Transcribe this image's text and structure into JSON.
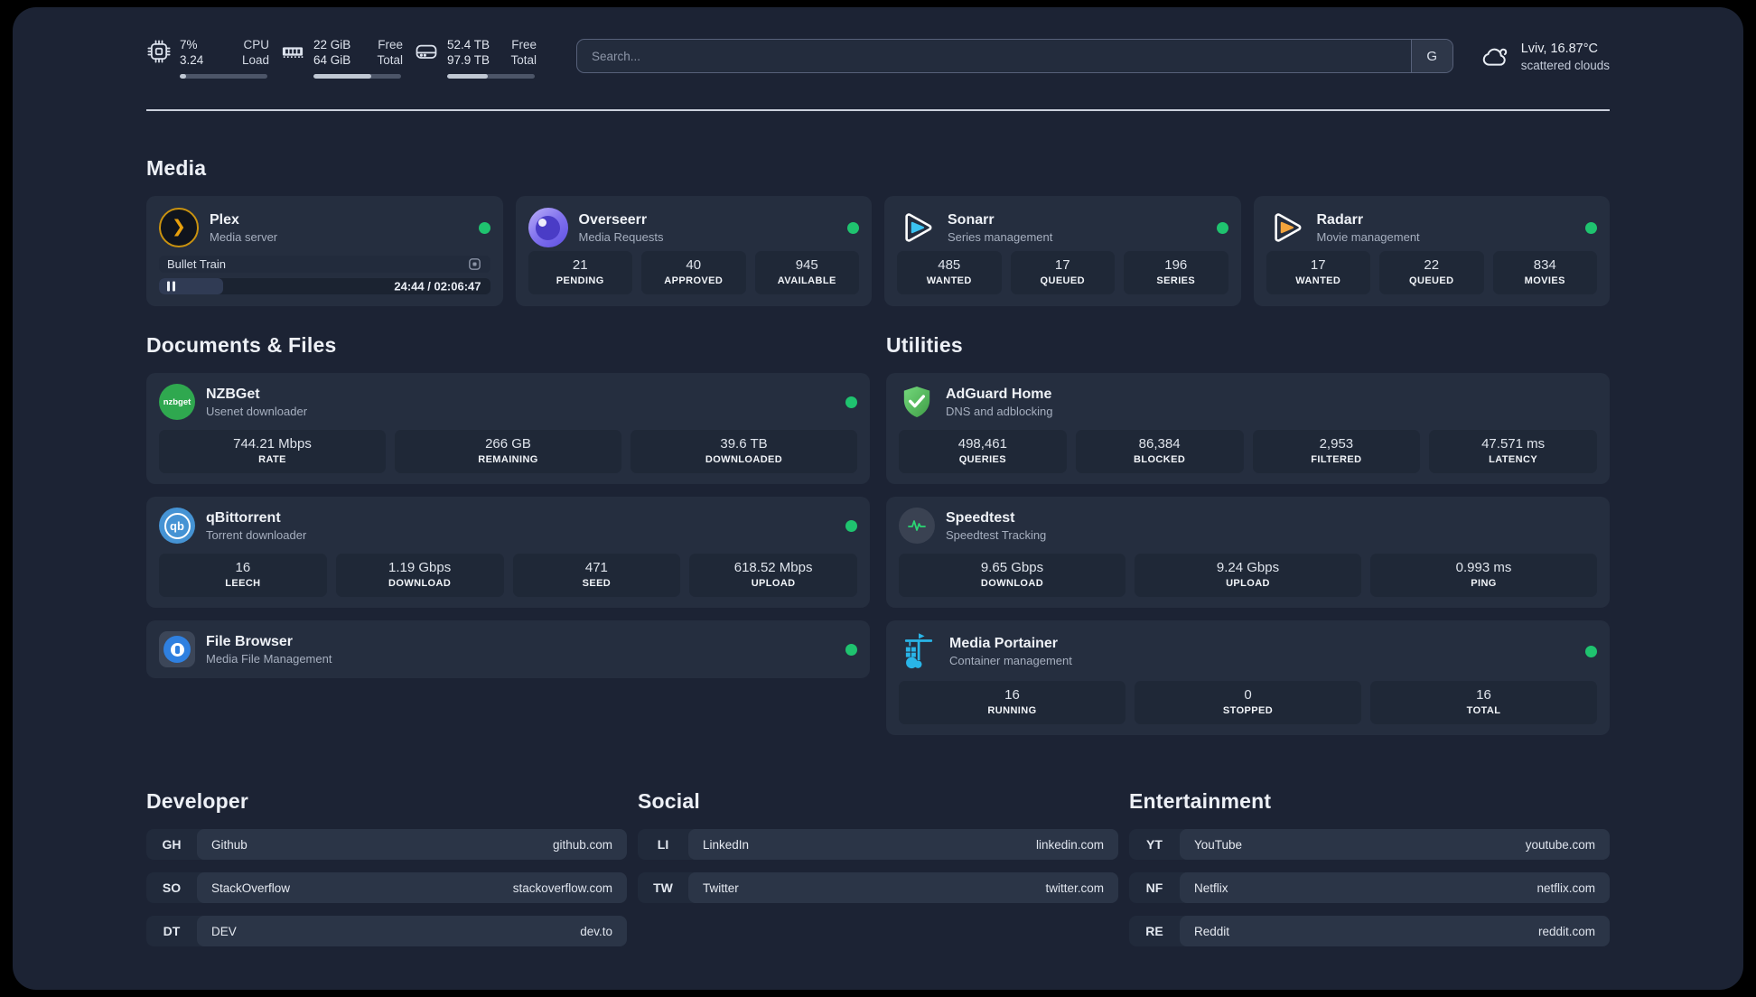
{
  "topbar": {
    "cpu": {
      "value_top": "7%",
      "value_bottom": "3.24",
      "label_top": "CPU",
      "label_bottom": "Load",
      "progress_pct": 7
    },
    "ram": {
      "value_top": "22 GiB",
      "value_bottom": "64 GiB",
      "label_top": "Free",
      "label_bottom": "Total",
      "progress_pct": 66
    },
    "disk": {
      "value_top": "52.4 TB",
      "value_bottom": "97.9 TB",
      "label_top": "Free",
      "label_bottom": "Total",
      "progress_pct": 46
    },
    "search": {
      "placeholder": "Search...",
      "engine_button": "G"
    },
    "weather": {
      "location": "Lviv, 16.87°C",
      "condition": "scattered clouds"
    }
  },
  "sections": {
    "media": "Media",
    "documents": "Documents & Files",
    "utilities": "Utilities"
  },
  "apps": {
    "plex": {
      "name": "Plex",
      "desc": "Media server",
      "now_playing": "Bullet Train",
      "time": "24:44 / 02:06:47",
      "progress_pct": 19.5
    },
    "overseerr": {
      "name": "Overseerr",
      "desc": "Media Requests",
      "stats": [
        {
          "value": "21",
          "label": "PENDING"
        },
        {
          "value": "40",
          "label": "APPROVED"
        },
        {
          "value": "945",
          "label": "AVAILABLE"
        }
      ]
    },
    "sonarr": {
      "name": "Sonarr",
      "desc": "Series management",
      "stats": [
        {
          "value": "485",
          "label": "WANTED"
        },
        {
          "value": "17",
          "label": "QUEUED"
        },
        {
          "value": "196",
          "label": "SERIES"
        }
      ]
    },
    "radarr": {
      "name": "Radarr",
      "desc": "Movie management",
      "stats": [
        {
          "value": "17",
          "label": "WANTED"
        },
        {
          "value": "22",
          "label": "QUEUED"
        },
        {
          "value": "834",
          "label": "MOVIES"
        }
      ]
    },
    "nzbget": {
      "name": "NZBGet",
      "desc": "Usenet downloader",
      "logo_text": "nzbget",
      "stats": [
        {
          "value": "744.21 Mbps",
          "label": "RATE"
        },
        {
          "value": "266 GB",
          "label": "REMAINING"
        },
        {
          "value": "39.6 TB",
          "label": "DOWNLOADED"
        }
      ]
    },
    "qbittorrent": {
      "name": "qBittorrent",
      "desc": "Torrent downloader",
      "logo_text": "qb",
      "stats": [
        {
          "value": "16",
          "label": "LEECH"
        },
        {
          "value": "1.19 Gbps",
          "label": "DOWNLOAD"
        },
        {
          "value": "471",
          "label": "SEED"
        },
        {
          "value": "618.52 Mbps",
          "label": "UPLOAD"
        }
      ]
    },
    "filebrowser": {
      "name": "File Browser",
      "desc": "Media File Management"
    },
    "adguard": {
      "name": "AdGuard Home",
      "desc": "DNS and adblocking",
      "stats": [
        {
          "value": "498,461",
          "label": "QUERIES"
        },
        {
          "value": "86,384",
          "label": "BLOCKED"
        },
        {
          "value": "2,953",
          "label": "FILTERED"
        },
        {
          "value": "47.571 ms",
          "label": "LATENCY"
        }
      ]
    },
    "speedtest": {
      "name": "Speedtest",
      "desc": "Speedtest Tracking",
      "stats": [
        {
          "value": "9.65 Gbps",
          "label": "DOWNLOAD"
        },
        {
          "value": "9.24 Gbps",
          "label": "UPLOAD"
        },
        {
          "value": "0.993 ms",
          "label": "PING"
        }
      ]
    },
    "portainer": {
      "name": "Media Portainer",
      "desc": "Container management",
      "stats": [
        {
          "value": "16",
          "label": "RUNNING"
        },
        {
          "value": "0",
          "label": "STOPPED"
        },
        {
          "value": "16",
          "label": "TOTAL"
        }
      ]
    }
  },
  "links": {
    "developer": {
      "title": "Developer",
      "items": [
        {
          "abbr": "GH",
          "name": "Github",
          "url": "github.com"
        },
        {
          "abbr": "SO",
          "name": "StackOverflow",
          "url": "stackoverflow.com"
        },
        {
          "abbr": "DT",
          "name": "DEV",
          "url": "dev.to"
        }
      ]
    },
    "social": {
      "title": "Social",
      "items": [
        {
          "abbr": "LI",
          "name": "LinkedIn",
          "url": "linkedin.com"
        },
        {
          "abbr": "TW",
          "name": "Twitter",
          "url": "twitter.com"
        }
      ]
    },
    "entertainment": {
      "title": "Entertainment",
      "items": [
        {
          "abbr": "YT",
          "name": "YouTube",
          "url": "youtube.com"
        },
        {
          "abbr": "NF",
          "name": "Netflix",
          "url": "netflix.com"
        },
        {
          "abbr": "RE",
          "name": "Reddit",
          "url": "reddit.com"
        }
      ]
    }
  },
  "colors": {
    "status_online": "#1fc36f",
    "plex_gold": "#e5a00d",
    "sonarr_cyan": "#3bc3f2",
    "radarr_orange": "#f2a33c",
    "adguard_green": "#4caf50",
    "portainer_blue": "#29b5e8",
    "background": "#1c2334",
    "card": "#252e3f"
  }
}
